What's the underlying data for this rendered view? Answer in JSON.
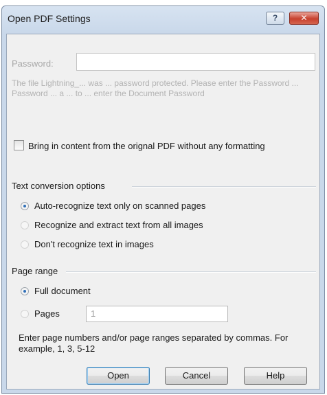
{
  "dialog": {
    "title": "Open PDF Settings",
    "help_symbol": "?",
    "close_symbol": "✕"
  },
  "password": {
    "label": "Password:",
    "value": "",
    "note": "The file Lightning_... was ... password protected. Please enter the Password ... Password ... a ... to ... enter the Document Password"
  },
  "formatting_checkbox": {
    "label": "Bring in content from the orignal PDF without any formatting",
    "checked": false
  },
  "text_conversion": {
    "title": "Text conversion options",
    "options": [
      {
        "label": "Auto-recognize text only on scanned pages",
        "selected": true
      },
      {
        "label": "Recognize and extract text from all images",
        "selected": false
      },
      {
        "label": "Don't recognize text in images",
        "selected": false
      }
    ]
  },
  "page_range": {
    "title": "Page range",
    "options": [
      {
        "label": "Full document",
        "selected": true
      },
      {
        "label": "Pages",
        "selected": false
      }
    ],
    "pages_value": "1",
    "note": "Enter page numbers and/or page ranges separated by commas. For example, 1, 3, 5-12"
  },
  "buttons": {
    "open": "Open",
    "cancel": "Cancel",
    "help": "Help"
  }
}
